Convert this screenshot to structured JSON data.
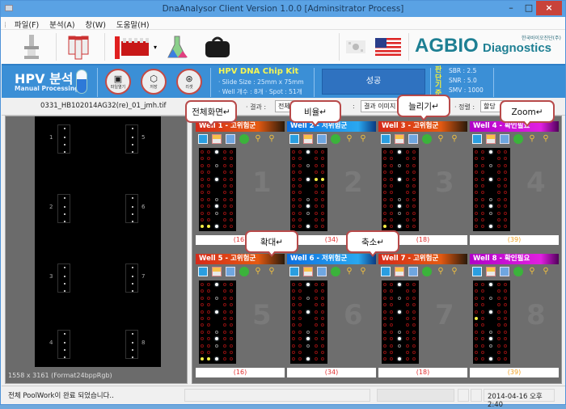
{
  "window": {
    "title": "DnaAnalysor Client Version 1.0.0 [Adminsitrator Process]",
    "min_label": "–",
    "max_label": "□",
    "close_label": "×"
  },
  "menu": [
    "파일(F)",
    "분석(A)",
    "창(W)",
    "도움말(H)"
  ],
  "toolbar": {
    "buttons": [
      "microscope-icon",
      "sample-tubes-icon",
      "test-tube-rack-icon",
      "flask-icon",
      "doctor-bag-icon"
    ],
    "dropdown_glyph": "▾",
    "language_flags": [
      "korea-flag-icon",
      "usa-flag-icon"
    ],
    "logo_text": "AGBIO",
    "logo_sub": "Diagnostics",
    "logo_korean": "한국바이오진단(주)"
  },
  "hpv_panel": {
    "title": "HPV 분석",
    "subtitle": "Manual Processing",
    "buttons": [
      {
        "icon": "▣",
        "label": "파일열기"
      },
      {
        "icon": "⬡",
        "label": "저장"
      },
      {
        "icon": "⊛",
        "label": "리셋"
      }
    ],
    "kit_title": "HPV DNA Chip Kit",
    "kit_lines": [
      "· Slide Size : 25mm x 75mm",
      "· Well 개수 : 8개 · Spot : 51개"
    ],
    "status": "성공",
    "criteria_label": "판단기준",
    "criteria": [
      "SBR : 2.5",
      "SNR : 5.0",
      "SMV : 1000"
    ]
  },
  "filebar": {
    "filename": "0331_HB102014AG32(re)_01_jmh.tif",
    "result_label": "· 결과 :",
    "result_value": "전체",
    "image_label": ":",
    "image_value": "결과 이미지",
    "sort_label": "· 정렬 :",
    "sort_value": "할당"
  },
  "slide": {
    "slot_numbers": [
      "1",
      "2",
      "3",
      "4",
      "5",
      "6",
      "7",
      "8"
    ],
    "image_info": "1558 x 3161 (Format24bppRgb)"
  },
  "wells": [
    {
      "title": "Well 1 - 고위험군",
      "color": "red",
      "number": "1",
      "count": "(16)",
      "count_color": "red"
    },
    {
      "title": "Well 2 - 저위험군",
      "color": "blue",
      "number": "2",
      "count": "(34)",
      "count_color": "red"
    },
    {
      "title": "Well 3 - 고위험군",
      "color": "red",
      "number": "3",
      "count": "(18)",
      "count_color": "red"
    },
    {
      "title": "Well 4 - 확인필요",
      "color": "mag",
      "number": "4",
      "count": "(39)",
      "count_color": "orange"
    },
    {
      "title": "Well 5 - 고위험군",
      "color": "red",
      "number": "5",
      "count": "(16)",
      "count_color": "red"
    },
    {
      "title": "Well 6 - 저위험군",
      "color": "blue",
      "number": "6",
      "count": "(34)",
      "count_color": "red"
    },
    {
      "title": "Well 7 - 고위험군",
      "color": "red",
      "number": "7",
      "count": "(18)",
      "count_color": "red"
    },
    {
      "title": "Well 8 - 확인필요",
      "color": "mag",
      "number": "8",
      "count": "(39)",
      "count_color": "orange"
    }
  ],
  "well_tools": [
    "fullscreen-icon",
    "ratio-icon",
    "stretch-icon",
    "zoom-icon",
    "zoom-in-icon",
    "zoom-out-icon"
  ],
  "callouts": {
    "fullscreen": "전체화면↵",
    "ratio": "비율↵",
    "stretch": "늘리기↵",
    "zoom": "Zoom↵",
    "zoom_in": "확대↵",
    "zoom_out": "축소↵"
  },
  "statusbar": {
    "message": "전체 PoolWork이 완료 되었습니다..",
    "datetime": "2014-04-16 오후 2:40"
  }
}
